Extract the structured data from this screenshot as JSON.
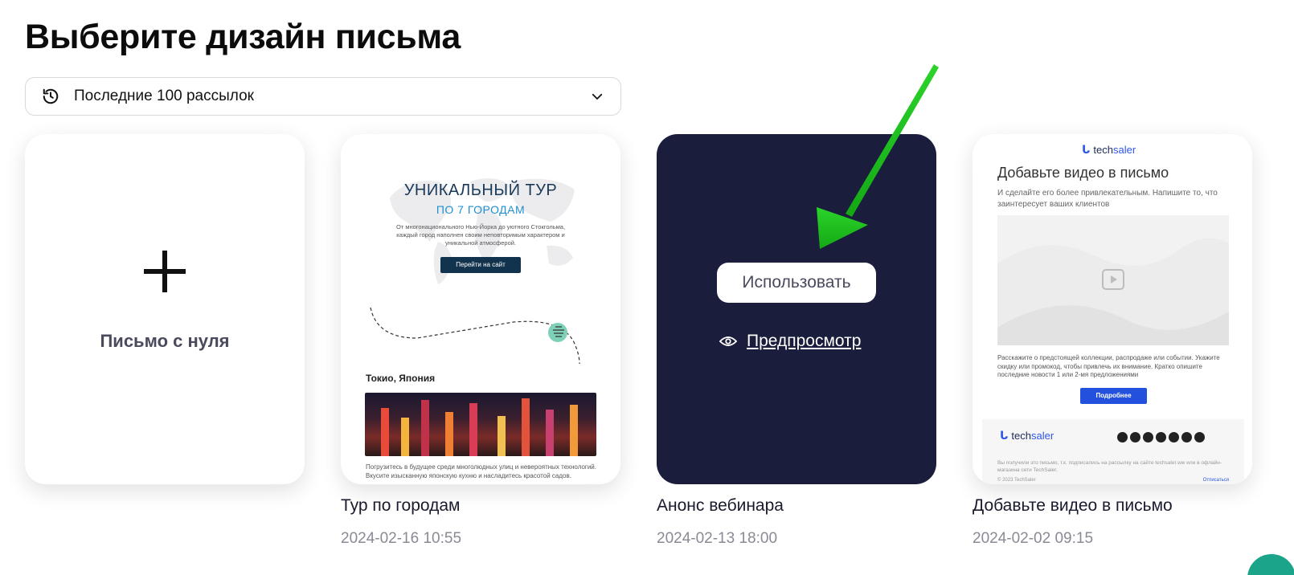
{
  "page_title": "Выберите дизайн письма",
  "filter": {
    "icon": "history-icon",
    "label": "Последние 100 рассылок",
    "chevron": "chevron-down-icon"
  },
  "cards": {
    "blank": {
      "icon": "plus-icon",
      "label": "Письмо с нуля"
    },
    "tour": {
      "title": "Тур по городам",
      "date": "2024-02-16 10:55",
      "preview": {
        "heading": "УНИКАЛЬНЫЙ ТУР",
        "subheading": "ПО 7 ГОРОДАМ",
        "text": "От многонационального Нью-Йорка до уютного Стокгольма, каждый город наполнен своим неповторимым характером и уникальной атмосферой.",
        "button": "Перейти на сайт",
        "city": "Токио, Япония",
        "body": "Погрузитесь в будущее среди многолюдных улиц и невероятных технологий. Вкусите изысканную японскую кухню и насладитесь красотой садов."
      }
    },
    "webinar": {
      "title": "Анонс вебинара",
      "date": "2024-02-13 18:00",
      "use_button": "Использовать",
      "preview_link": "Предпросмотр"
    },
    "video": {
      "title": "Добавьте видео в письмо",
      "date": "2024-02-02 09:15",
      "preview": {
        "logo_prefix": "tech",
        "logo_suffix": "saler",
        "heading": "Добавьте видео в письмо",
        "sub": "И сделайте его более привлекательным. Напишите то, что заинтересует ваших клиентов",
        "desc": "Расскажите о предстоящей коллекции, распродаже или событии. Укажите скидку или промокод, чтобы привлечь их внимание. Кратко опишите последние новости 1 или 2-мя предложениями",
        "button": "Подробнее",
        "footer_text": "Вы получили это письмо, т.к. подписались на рассылку на сайте techsaler.ww или в офлайн-магазина сети TechSaler.",
        "copyright": "© 2023 TechSaler",
        "unsubscribe": "Отписаться"
      }
    }
  },
  "colors": {
    "dark_card": "#1a1d3b",
    "arrow": "#1fbf1f",
    "accent_blue": "#2d56e8"
  }
}
